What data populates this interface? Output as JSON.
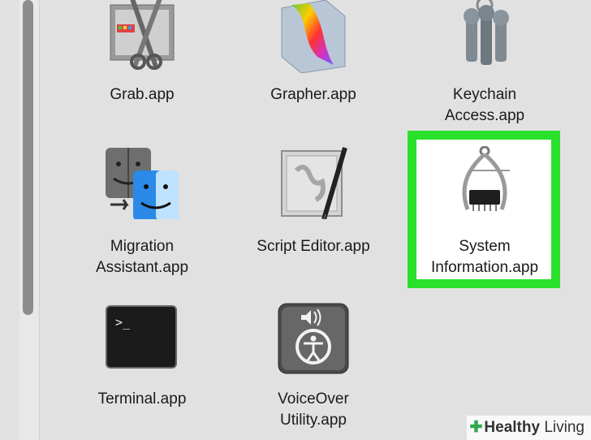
{
  "apps": [
    {
      "label": "Grab.app"
    },
    {
      "label": "Grapher.app"
    },
    {
      "label_line1": "Keychain",
      "label_line2": "Access.app"
    },
    {
      "label_line1": "Migration",
      "label_line2": "Assistant.app"
    },
    {
      "label": "Script Editor.app"
    },
    {
      "label_line1": "System",
      "label_line2": "Information.app",
      "highlighted": true
    },
    {
      "label": "Terminal.app",
      "prompt": ">_"
    },
    {
      "label_line1": "VoiceOver",
      "label_line2": "Utility.app"
    }
  ],
  "highlight_color": "#29e02b",
  "watermark": {
    "brand_bold": "Healthy",
    "brand_light": "Living"
  }
}
